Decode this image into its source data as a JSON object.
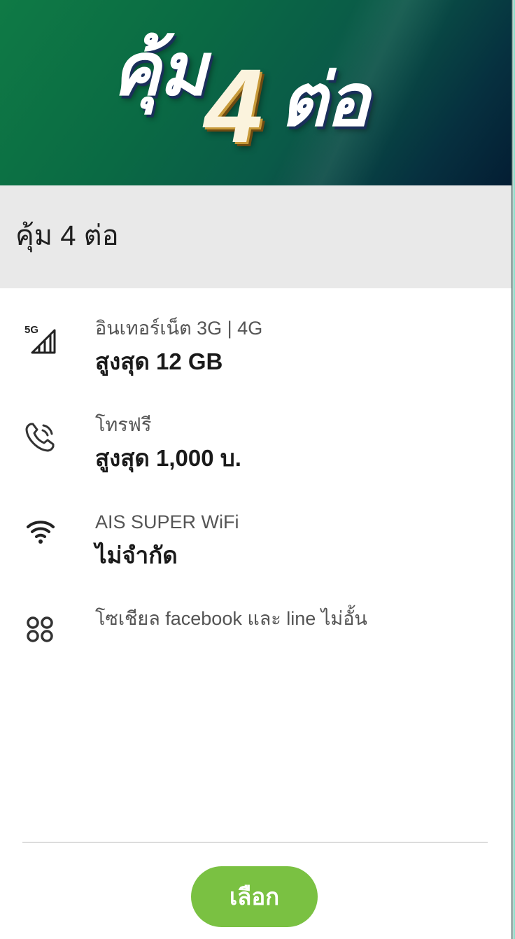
{
  "banner": {
    "text_left": "คุ้ม",
    "text_number": "4",
    "text_right": "ต่อ"
  },
  "package": {
    "title": "คุ้ม 4 ต่อ"
  },
  "features": [
    {
      "icon": "5g-signal-icon",
      "icon_text": "5G",
      "label": "อินเทอร์เน็ต 3G | 4G",
      "value": "สูงสุด 12 GB"
    },
    {
      "icon": "phone-call-icon",
      "label": "โทรฟรี",
      "value": "สูงสุด 1,000 บ."
    },
    {
      "icon": "wifi-icon",
      "label": "AIS SUPER WiFi",
      "value": "ไม่จำกัด"
    },
    {
      "icon": "social-apps-icon",
      "label": "โซเชียล facebook และ line ไม่อั้น"
    }
  ],
  "actions": {
    "select_label": "เลือก"
  },
  "colors": {
    "accent_green": "#7ac142",
    "banner_green": "#0f7a45",
    "title_bar_bg": "#e9e9e9"
  }
}
